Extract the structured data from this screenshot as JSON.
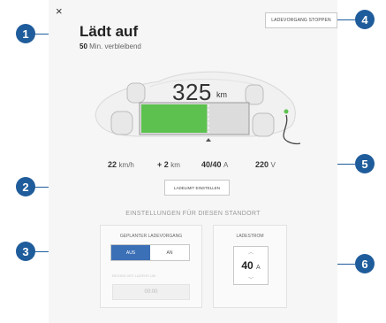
{
  "header": {
    "close_glyph": "×",
    "title": "Lädt auf",
    "minutes": "50",
    "minutes_suffix": "Min. verbleibend",
    "stop_button": "LADEVORGANG STOPPEN"
  },
  "car": {
    "range_value": "325",
    "range_unit": "km",
    "battery_fill_fraction": 0.62,
    "battery_color": "#5cc14e"
  },
  "stats": {
    "speed_value": "22",
    "speed_unit": "km/h",
    "added_prefix": "+ 2",
    "added_unit": "km",
    "current_value": "40/40",
    "current_unit": "A",
    "voltage_value": "220",
    "voltage_unit": "V"
  },
  "limit_button": "LADELIMIT EINSTELLEN",
  "location_section": "EINSTELLUNGEN FÜR DIESEN STANDORT",
  "scheduled": {
    "title": "GEPLANTER LADEVORGANG",
    "option_off": "AUS",
    "option_on": "AN",
    "start_label": "BEGINN DES LADENS UM",
    "time_value": "00:00"
  },
  "charge_current": {
    "title": "LADESTROM",
    "value": "40",
    "unit": "A",
    "up_glyph": "︿",
    "down_glyph": "﹀"
  },
  "callouts": [
    "1",
    "2",
    "3",
    "4",
    "5",
    "6"
  ],
  "colors": {
    "accent": "#3b6fb6",
    "callout": "#1f5c9b",
    "battery_green": "#5cc14e"
  }
}
